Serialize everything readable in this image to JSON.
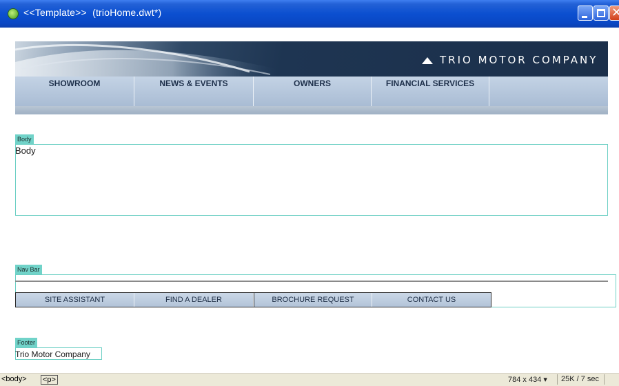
{
  "window": {
    "title": "<<Template>>  (trioHome.dwt*)",
    "app_icon": "dreamweaver-icon",
    "controls": [
      "minimize-icon",
      "maximize-icon",
      "close-icon"
    ]
  },
  "banner": {
    "brand": "TRIO MOTOR COMPANY",
    "logo_icon": "triangle-logo-icon"
  },
  "main_nav": {
    "items": [
      {
        "label": "SHOWROOM"
      },
      {
        "label": "NEWS & EVENTS"
      },
      {
        "label": "OWNERS"
      },
      {
        "label": "FINANCIAL SERVICES"
      },
      {
        "label": ""
      }
    ]
  },
  "regions": {
    "body": {
      "tab": "Body",
      "content": "Body"
    },
    "navbar": {
      "tab": "Nav Bar"
    },
    "footer": {
      "tab": "Footer",
      "content": "Trio Motor Company"
    }
  },
  "sub_nav": {
    "items": [
      {
        "label": "SITE ASSISTANT"
      },
      {
        "label": "FIND A DEALER"
      },
      {
        "label": "BROCHURE REQUEST"
      },
      {
        "label": "CONTACT US"
      }
    ]
  },
  "status_bar": {
    "tags": [
      "<body>",
      "<p>"
    ],
    "dimensions": "784 x 434",
    "download": "25K / 7 sec"
  },
  "colors": {
    "title_bar": "#0b4fd0",
    "region_tab": "#71d3c9",
    "banner_dark": "#1e3552",
    "nav_bg": "#b2c3d8"
  }
}
